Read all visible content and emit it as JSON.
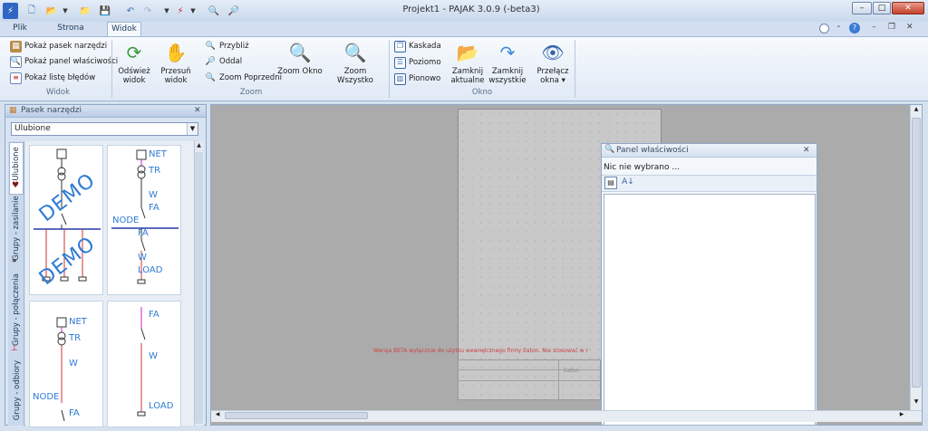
{
  "window": {
    "title": "Projekt1 - PAJAK 3.0.9 (-beta3)",
    "minimize": "–",
    "maximize": "□",
    "close": "✕"
  },
  "tabs": [
    {
      "label": "Plik"
    },
    {
      "label": "Strona domowa"
    },
    {
      "label": "Widok"
    }
  ],
  "ribbon": {
    "widok_group": {
      "label": "Widok",
      "items": [
        "Pokaż pasek narzędzi",
        "Pokaż panel właściwości",
        "Pokaż listę błędów"
      ]
    },
    "zoom_group": {
      "label": "Zoom",
      "refresh": [
        "Odśwież",
        "widok"
      ],
      "pan": [
        "Przesuń",
        "widok"
      ],
      "zoom_in": "Przybliż",
      "zoom_out": "Oddal",
      "zoom_prev": "Zoom Poprzedni",
      "zoom_window": "Zoom Okno",
      "zoom_all": "Zoom Wszystko"
    },
    "okno_group": {
      "label": "Okno",
      "cascade": "Kaskada",
      "horizontal": "Poziomo",
      "vertical": "Pionowo",
      "close_current": [
        "Zamknij",
        "aktualne"
      ],
      "close_all": [
        "Zamknij",
        "wszystkie"
      ],
      "switch": [
        "Przełącz",
        "okna ▾"
      ]
    }
  },
  "toolbox": {
    "title": "Pasek narzędzi",
    "close": "✕",
    "dropdown_value": "Ulubione",
    "side_tabs": [
      "Ulubione",
      "Grupy - zasilanie",
      "Grupy - połączenia",
      "Grupy - odbiory"
    ],
    "tile1": {
      "watermark": "DEMO"
    },
    "tile2": {
      "labels": [
        "NET",
        "TR",
        "W",
        "FA",
        "NODE",
        "FA",
        "W",
        "LOAD"
      ]
    },
    "tile3": {
      "labels": [
        "NET",
        "TR",
        "W",
        "NODE",
        "FA"
      ]
    },
    "tile4": {
      "labels": [
        "FA",
        "W",
        "LOAD"
      ]
    }
  },
  "properties": {
    "title": "Panel właściwości",
    "close": "✕",
    "status": "Nic nie wybrano ..."
  },
  "sheet": {
    "beta_text": "Wersja BETA wyłącznie do użytku wewnętrznego firmy Eaton. Nie stosować w r",
    "titleblock_name": "Eaton"
  },
  "colors": {
    "accent": "#2e7bd6",
    "ribbon_border": "#9eb6d6",
    "canvas": "#ababab"
  }
}
